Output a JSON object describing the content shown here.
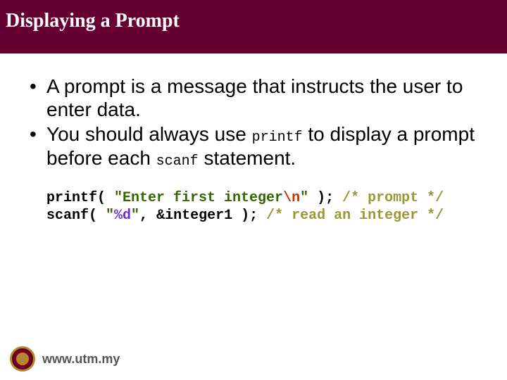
{
  "title": "Displaying a Prompt",
  "bullets": [
    {
      "pre": "A prompt is a message that instructs the user to enter data.",
      "code": "",
      "post": ""
    },
    {
      "pre": "You should always use ",
      "code": "printf",
      "mid": " to display a prompt before each ",
      "code2": "scanf",
      "post": " statement."
    }
  ],
  "code_example": {
    "line1": {
      "t1": "printf( ",
      "s1a": "\"Enter first integer",
      "esc": "\\n",
      "s1b": "\"",
      "t2": " ); ",
      "c1": "/* prompt */"
    },
    "line2": {
      "t1": "scanf( ",
      "s2a": "\"",
      "fmt": "%d",
      "s2b": "\"",
      "t2": ", &integer1 ); ",
      "c2": "/* read an integer */"
    }
  },
  "footer": {
    "url": "www.utm.my"
  }
}
